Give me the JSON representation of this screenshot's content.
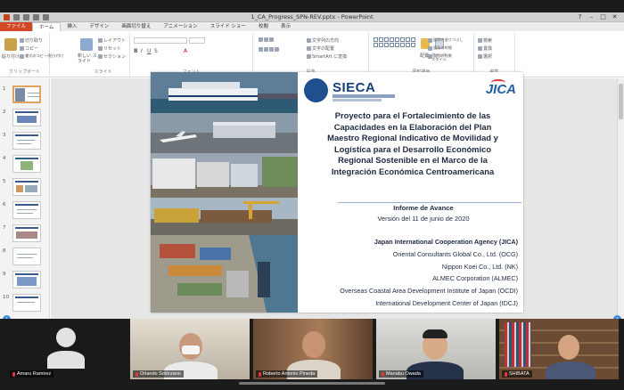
{
  "window": {
    "title": "1_CA_Progress_SPN-REV.pptx - PowerPoint",
    "controls": [
      "?",
      "–",
      "□",
      "✕"
    ]
  },
  "ribbon": {
    "tabs": [
      "ファイル",
      "ホーム",
      "挿入",
      "デザイン",
      "画面切り替え",
      "アニメーション",
      "スライド ショー",
      "校閲",
      "表示"
    ],
    "groups": {
      "clipboard": {
        "label": "クリップボード",
        "paste": "貼り付け",
        "cut": "切り取り",
        "copy": "コピー",
        "format_painter": "書式のコピー/貼り付け"
      },
      "slides": {
        "label": "スライド",
        "new_slide": "新しい スライド",
        "layout": "レイアウト",
        "reset": "リセット",
        "section": "セクション"
      },
      "font": {
        "label": "フォント"
      },
      "paragraph": {
        "label": "段落",
        "text_direction": "文字列の方向",
        "align_text": "文字の配置",
        "smartart": "SmartArt に変換"
      },
      "drawing": {
        "label": "図形描画",
        "arrange": "配置",
        "quick_styles": "クイック スタイル",
        "shape_fill": "図形の塗りつぶし",
        "shape_outline": "図形の枠線",
        "shape_effects": "図形の効果"
      },
      "editing": {
        "label": "編集",
        "find": "検索",
        "replace": "置換",
        "select": "選択"
      }
    }
  },
  "thumbnails": {
    "numbers": [
      "1",
      "2",
      "3",
      "4",
      "5",
      "6",
      "7",
      "8",
      "9",
      "10"
    ],
    "selected": "1"
  },
  "slide": {
    "logo_sieca": "SIECA",
    "logo_jica": "JICA",
    "title_lines": [
      "Proyecto para el Fortalecimiento de las",
      "Capacidades en la Elaboración del Plan",
      "Maestro Regional Indicativo de Movilidad y",
      "Logística para el Desarrollo Económico",
      "Regional Sostenible en el Marco de la",
      "Integración Económica Centroamericana"
    ],
    "report": "Informe de Avance",
    "version": "Versión del 11 de junio de 2020",
    "organizations": [
      "Japan International Cooperation Agency (JICA)",
      "Oriental Consultants Global Co., Ltd. (OCG)",
      "Nippon Koei Co., Ltd. (NK)",
      "ALMEC Corporation (ALMEC)",
      "Overseas Coastal Area Development Institute of Japan (OCDI)",
      "International Development Center of Japan (IDCJ)"
    ]
  },
  "participants": [
    {
      "name": "Amaru Ramirez",
      "video": false
    },
    {
      "name": "Orlando Solórzano",
      "video": true
    },
    {
      "name": "Roberto Antonio Pineda",
      "video": true
    },
    {
      "name": "Manabu Owada",
      "video": true
    },
    {
      "name": "SHIBATA",
      "video": true
    }
  ],
  "colors": {
    "file_tab": "#d24726",
    "slide_title": "#1e2a40",
    "sieca_blue": "#16407a",
    "jica_blue": "#1f5fa8",
    "mic_muted": "#e03b3b"
  }
}
